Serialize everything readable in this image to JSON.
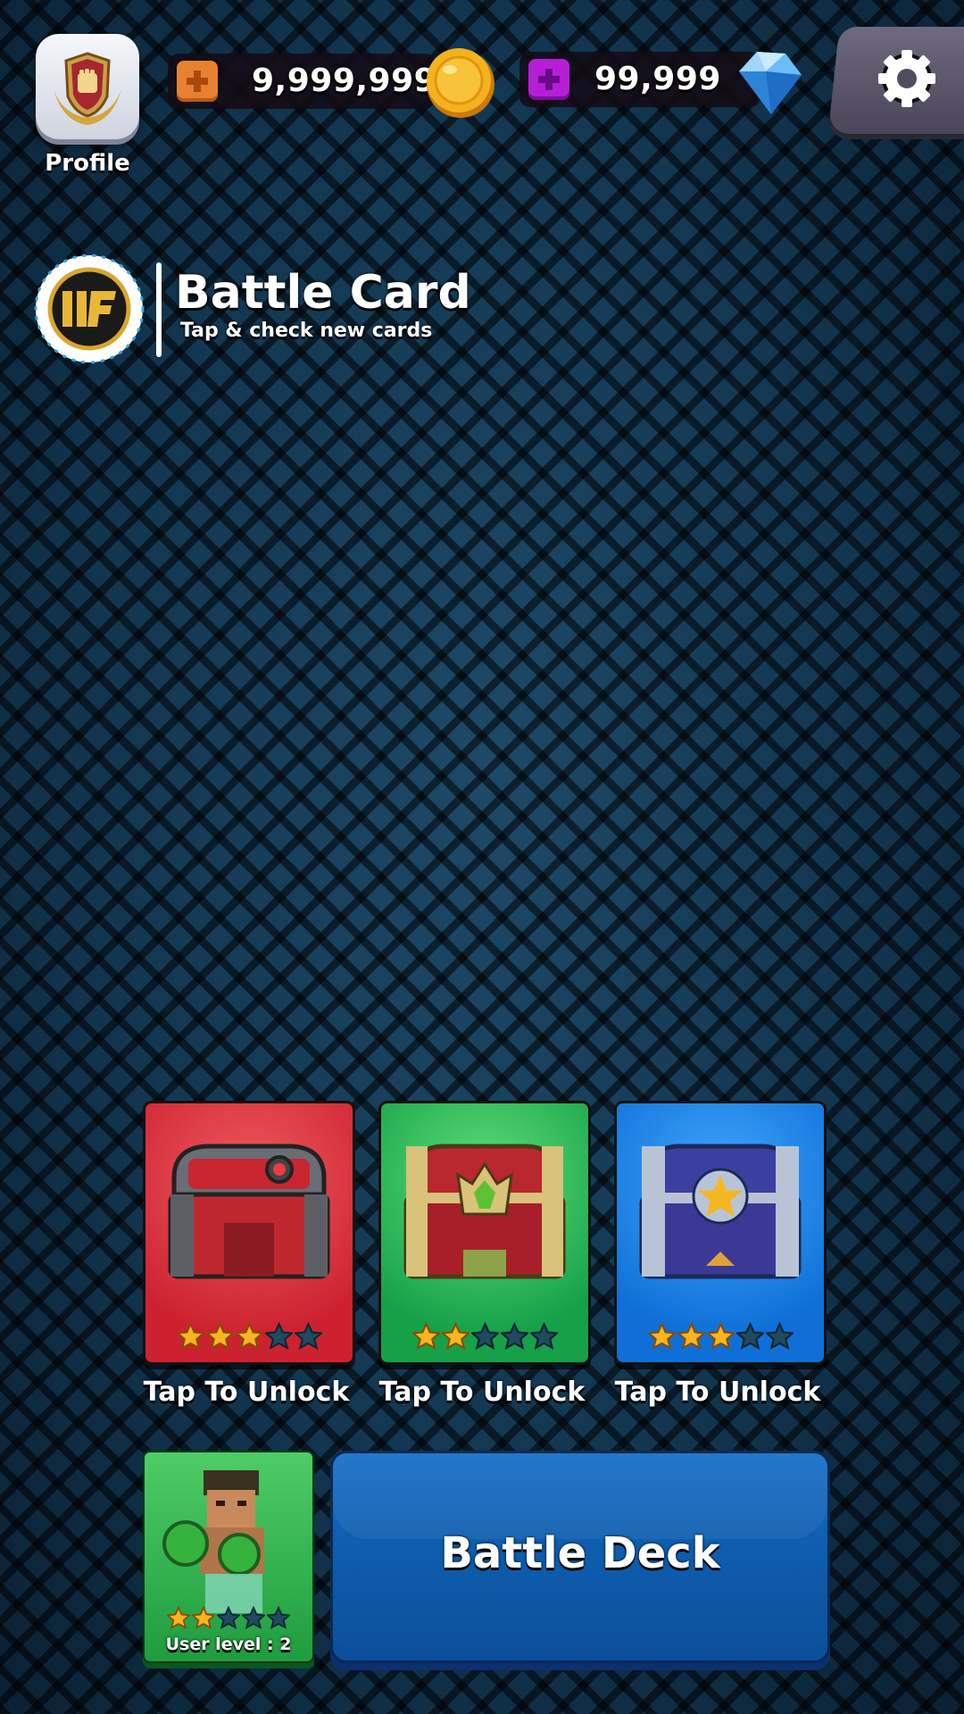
{
  "profile": {
    "label": "Profile",
    "icon": "fist-emblem-icon"
  },
  "currency": {
    "coins": {
      "value": "9,999,999",
      "icon": "gold-coin-icon",
      "add_icon": "plus-icon",
      "accent": "#e9802f"
    },
    "gems": {
      "value": "99,999",
      "icon": "blue-diamond-icon",
      "add_icon": "plus-icon",
      "accent": "#b41fd6"
    }
  },
  "settings": {
    "icon": "gear-icon"
  },
  "header": {
    "logo_icon": "iif-association-logo",
    "title": "Battle Card",
    "subtitle": "Tap & check new cards"
  },
  "chests": [
    {
      "label": "Tap To Unlock",
      "rarity": 3,
      "max": 5,
      "color": "#d8343c",
      "icon": "red-chest-icon"
    },
    {
      "label": "Tap To Unlock",
      "rarity": 2,
      "max": 5,
      "color": "#22b257",
      "icon": "green-chest-icon"
    },
    {
      "label": "Tap To Unlock",
      "rarity": 3,
      "max": 5,
      "color": "#1780e0",
      "icon": "blue-chest-icon"
    }
  ],
  "user_card": {
    "level_label": "User level : 2",
    "stars": 2,
    "max": 5,
    "icon": "boxer-character-icon"
  },
  "battle_deck": {
    "label": "Battle Deck"
  }
}
